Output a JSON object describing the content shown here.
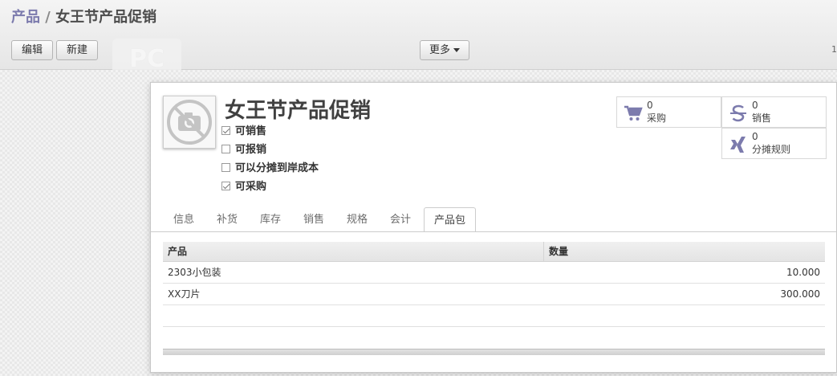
{
  "breadcrumb": {
    "parent": "产品",
    "separator": "/",
    "current": "女王节产品促销"
  },
  "toolbar": {
    "edit_label": "编辑",
    "new_label": "新建",
    "more_label": "更多",
    "edge_text": "1"
  },
  "watermark": {
    "text": "PC"
  },
  "product": {
    "name": "女王节产品促销",
    "checkboxes": [
      {
        "label": "可销售",
        "checked": true
      },
      {
        "label": "可报销",
        "checked": false
      },
      {
        "label": "可以分摊到岸成本",
        "checked": false
      },
      {
        "label": "可采购",
        "checked": true
      }
    ]
  },
  "stats": [
    {
      "icon": "cart-icon",
      "value": "0",
      "label": "采购"
    },
    {
      "icon": "dollar-icon",
      "value": "0",
      "label": "销售"
    },
    {
      "icon": "xing-icon",
      "value": "0",
      "label": "分摊规则"
    }
  ],
  "tabs": [
    {
      "label": "信息",
      "active": false
    },
    {
      "label": "补货",
      "active": false
    },
    {
      "label": "库存",
      "active": false
    },
    {
      "label": "销售",
      "active": false
    },
    {
      "label": "规格",
      "active": false
    },
    {
      "label": "会计",
      "active": false
    },
    {
      "label": "产品包",
      "active": true
    }
  ],
  "table": {
    "columns": [
      "产品",
      "数量"
    ],
    "rows": [
      {
        "product": "2303小包装",
        "qty": "10.000"
      },
      {
        "product": "XX刀片",
        "qty": "300.000"
      }
    ]
  },
  "colors": {
    "accent": "#7c7bad",
    "icon": "#7c7bad"
  }
}
